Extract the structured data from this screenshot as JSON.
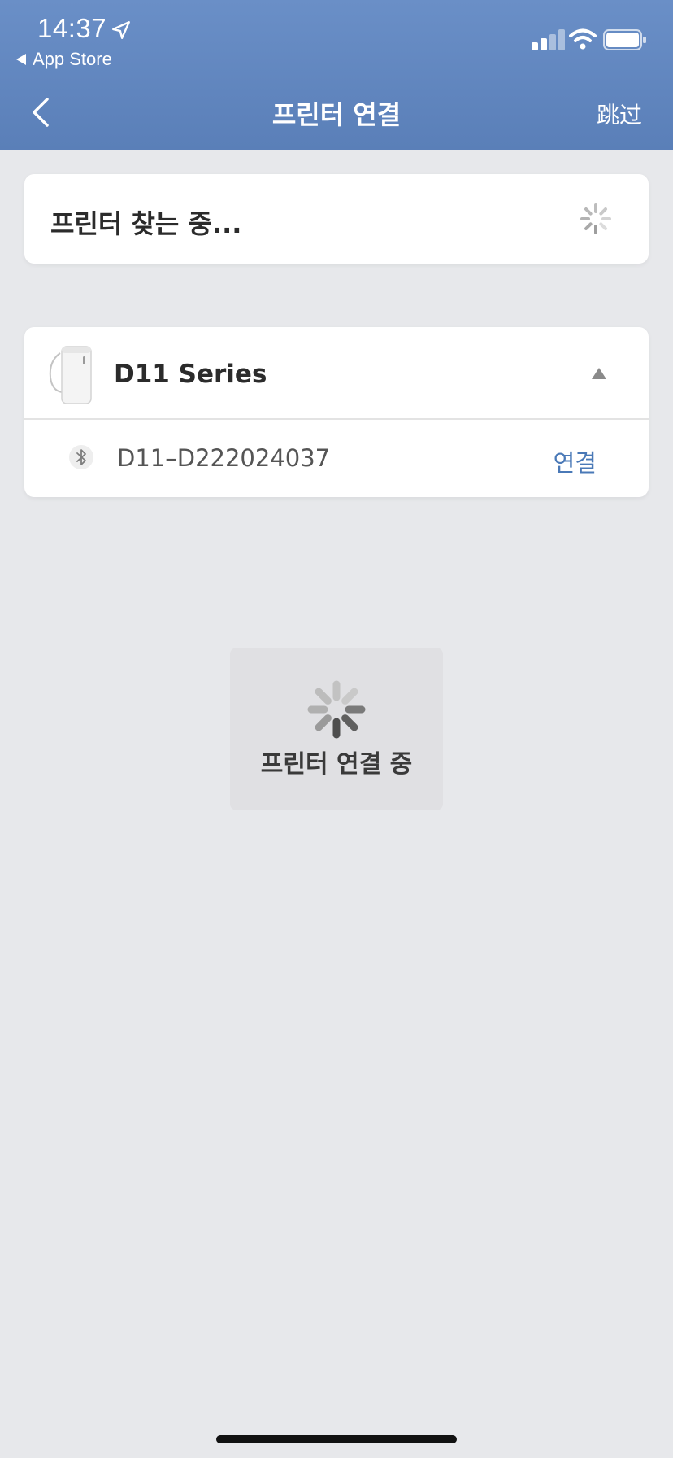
{
  "status_bar": {
    "time": "14:37",
    "back_app": "App Store"
  },
  "nav": {
    "title": "프린터 연결",
    "skip": "跳过"
  },
  "search": {
    "text": "프린터 찾는 중..."
  },
  "device_group": {
    "series": "D11 Series",
    "devices": [
      {
        "id": "D11–D222024037",
        "action": "연결"
      }
    ]
  },
  "toast": {
    "text": "프린터 연결 중"
  },
  "colors": {
    "header": "#5f84bd",
    "background": "#e7e8eb",
    "accent": "#4a79b7"
  }
}
